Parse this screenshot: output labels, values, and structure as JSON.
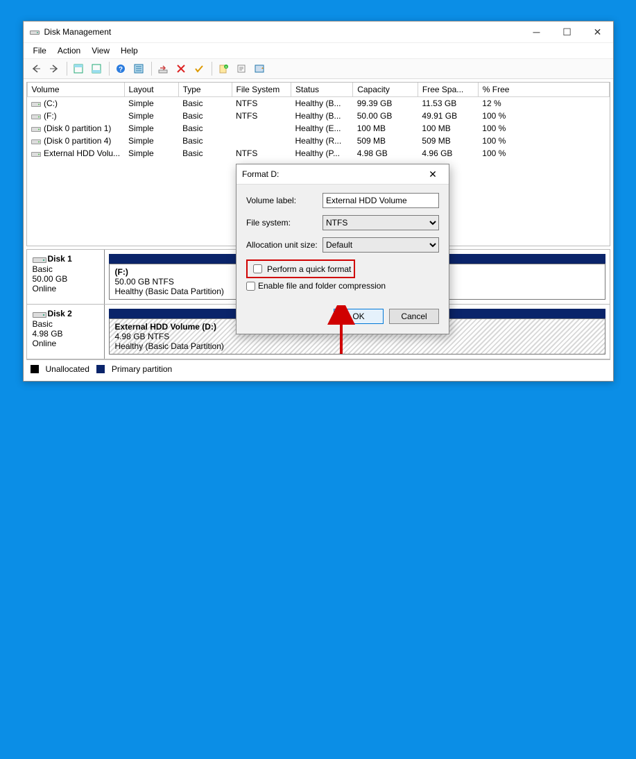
{
  "window": {
    "title": "Disk Management",
    "menus": [
      "File",
      "Action",
      "View",
      "Help"
    ]
  },
  "columns": [
    "Volume",
    "Layout",
    "Type",
    "File System",
    "Status",
    "Capacity",
    "Free Spa...",
    "% Free"
  ],
  "rows": [
    {
      "vol": "(C:)",
      "layout": "Simple",
      "type": "Basic",
      "fs": "NTFS",
      "status": "Healthy (B...",
      "cap": "99.39 GB",
      "free": "11.53 GB",
      "pct": "12 %"
    },
    {
      "vol": "(F:)",
      "layout": "Simple",
      "type": "Basic",
      "fs": "NTFS",
      "status": "Healthy (B...",
      "cap": "50.00 GB",
      "free": "49.91 GB",
      "pct": "100 %"
    },
    {
      "vol": "(Disk 0 partition 1)",
      "layout": "Simple",
      "type": "Basic",
      "fs": "",
      "status": "Healthy (E...",
      "cap": "100 MB",
      "free": "100 MB",
      "pct": "100 %"
    },
    {
      "vol": "(Disk 0 partition 4)",
      "layout": "Simple",
      "type": "Basic",
      "fs": "",
      "status": "Healthy (R...",
      "cap": "509 MB",
      "free": "509 MB",
      "pct": "100 %"
    },
    {
      "vol": "External HDD Volu...",
      "layout": "Simple",
      "type": "Basic",
      "fs": "NTFS",
      "status": "Healthy (P...",
      "cap": "4.98 GB",
      "free": "4.96 GB",
      "pct": "100 %"
    }
  ],
  "disks": [
    {
      "name": "Disk 1",
      "kind": "Basic",
      "size": "50.00 GB",
      "state": "Online",
      "part": {
        "title": "(F:)",
        "line2": "50.00 GB NTFS",
        "line3": "Healthy (Basic Data Partition)",
        "hatch": false
      }
    },
    {
      "name": "Disk 2",
      "kind": "Basic",
      "size": "4.98 GB",
      "state": "Online",
      "part": {
        "title": "External HDD Volume  (D:)",
        "line2": "4.98 GB NTFS",
        "line3": "Healthy (Basic Data Partition)",
        "hatch": true
      }
    }
  ],
  "legend": {
    "unalloc": "Unallocated",
    "primary": "Primary partition"
  },
  "dialog": {
    "title": "Format D:",
    "labels": {
      "volLabel": "Volume label:",
      "fs": "File system:",
      "alloc": "Allocation unit size:",
      "quick": "Perform a quick format",
      "compress": "Enable file and folder compression"
    },
    "values": {
      "volLabel": "External HDD Volume",
      "fs": "NTFS",
      "alloc": "Default"
    },
    "buttons": {
      "ok": "OK",
      "cancel": "Cancel"
    }
  }
}
